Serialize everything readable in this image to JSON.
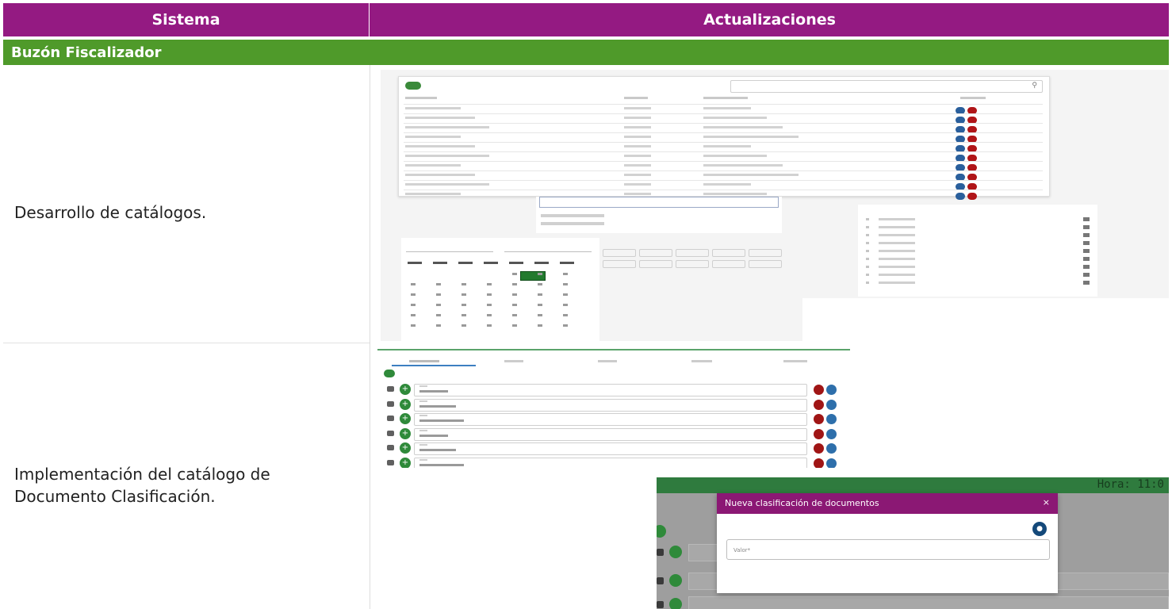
{
  "header": {
    "sistema": "Sistema",
    "actualizaciones": "Actualizaciones"
  },
  "section": {
    "title": "Buzón Fiscalizador"
  },
  "rows": [
    {
      "description": "Desarrollo de catálogos."
    },
    {
      "description_line1": "Implementación del catálogo de",
      "description_line2": "Documento Clasificación."
    }
  ],
  "shot3": {
    "hora": "Hora: 11:0",
    "modal_title": "Nueva clasificación de documentos",
    "close_glyph": "×",
    "input_placeholder": "Valor*"
  },
  "colors": {
    "header_purple": "#941a82",
    "section_green": "#4f9a2a",
    "modal_purple": "#8b1874",
    "topbar_green": "#2f7b3e"
  },
  "icons": [
    "search-icon",
    "edit-icon",
    "delete-icon",
    "plus-icon",
    "save-icon",
    "close-icon",
    "drag-handle-icon"
  ]
}
